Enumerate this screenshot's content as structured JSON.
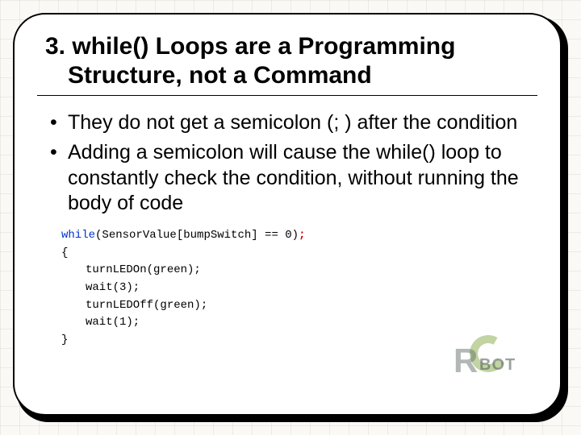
{
  "slide": {
    "title_line1": "3. while() Loops are a Programming",
    "title_line2": "Structure, not a Command",
    "bullets": [
      "They do not get a semicolon (; ) after the condition",
      "Adding a semicolon will cause the while() loop to constantly check the condition, without running the body of code"
    ],
    "code": {
      "keyword": "while",
      "condition_open": "(SensorValue[bumpSwitch] == 0)",
      "err_semicolon": ";",
      "brace_open": "{",
      "body": [
        "turnLEDOn(green);",
        "wait(3);",
        "turnLEDOff(green);",
        "wait(1);"
      ],
      "brace_close": "}"
    },
    "logo": {
      "r": "R",
      "bot": "BOT"
    }
  }
}
